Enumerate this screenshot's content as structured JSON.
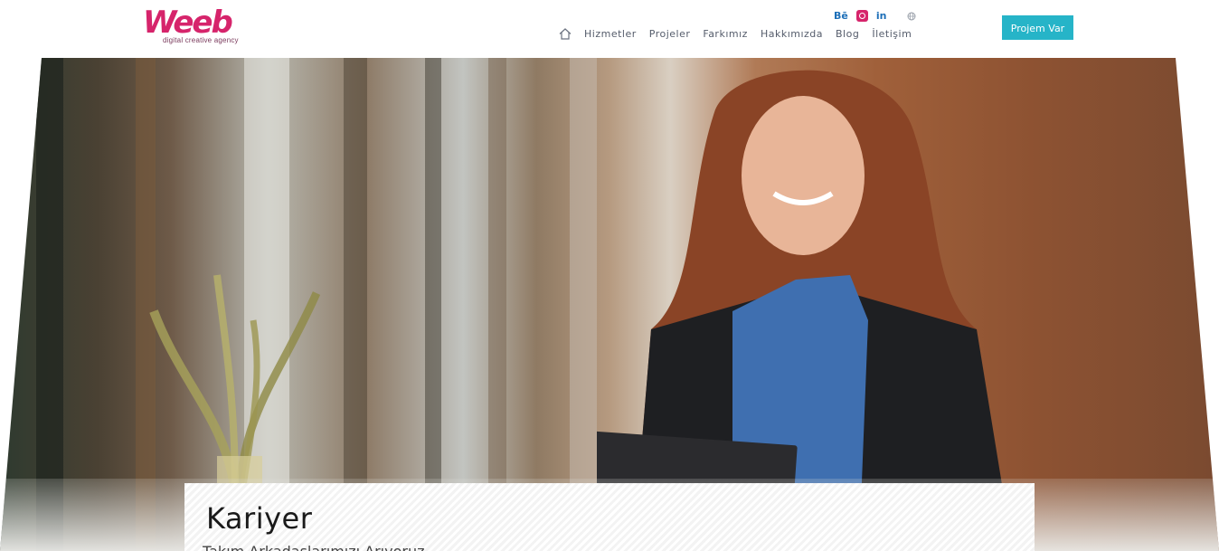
{
  "header": {
    "logo": {
      "word": "Weeb",
      "tagline": "digital creative agency"
    },
    "nav": [
      "Hizmetler",
      "Projeler",
      "Farkımız",
      "Hakkımızda",
      "Blog",
      "İletişim"
    ],
    "social": {
      "behance": "Bē",
      "linkedin": "in"
    },
    "cta_label": "Projem Var"
  },
  "hero": {
    "title": "Kariyer",
    "subtitle": "Takım Arkadaşlarımızı Arıyoruz"
  },
  "colors": {
    "brand": "#d6246b",
    "cta": "#26b4c8",
    "nav_text": "#555c6b"
  },
  "icons": [
    "home-icon",
    "behance-icon",
    "instagram-icon",
    "linkedin-icon",
    "globe-icon"
  ]
}
